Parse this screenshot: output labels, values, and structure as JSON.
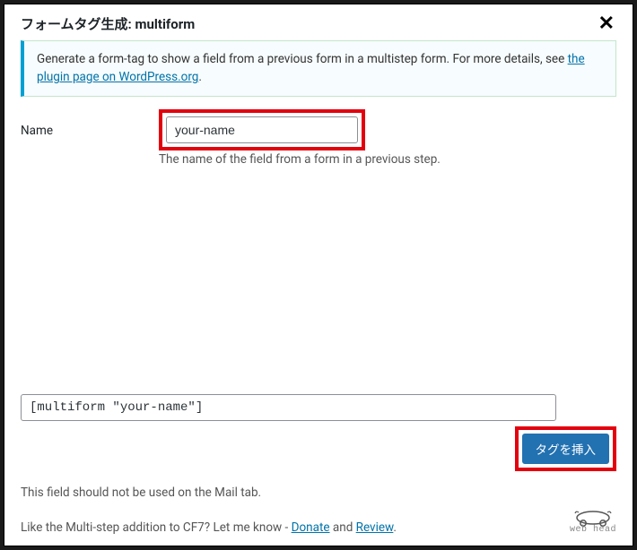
{
  "header": {
    "title": "フォームタグ生成: multiform"
  },
  "info": {
    "text_before_link": "Generate a form-tag to show a field from a previous form in a multistep form. For more details, see ",
    "link_text": "the plugin page on WordPress.org",
    "text_after_link": "."
  },
  "form": {
    "name_label": "Name",
    "name_value": "your-name",
    "name_help": "The name of the field from a form in a previous step."
  },
  "output": {
    "tag": "[multiform \"your-name\"]",
    "insert_label": "タグを挿入"
  },
  "footer": {
    "note": "This field should not be used on the Mail tab.",
    "promo_before": "Like the Multi-step addition to CF7? Let me know - ",
    "donate": "Donate",
    "and": " and ",
    "review": "Review",
    "promo_after": ".",
    "logo_text": "web head"
  }
}
